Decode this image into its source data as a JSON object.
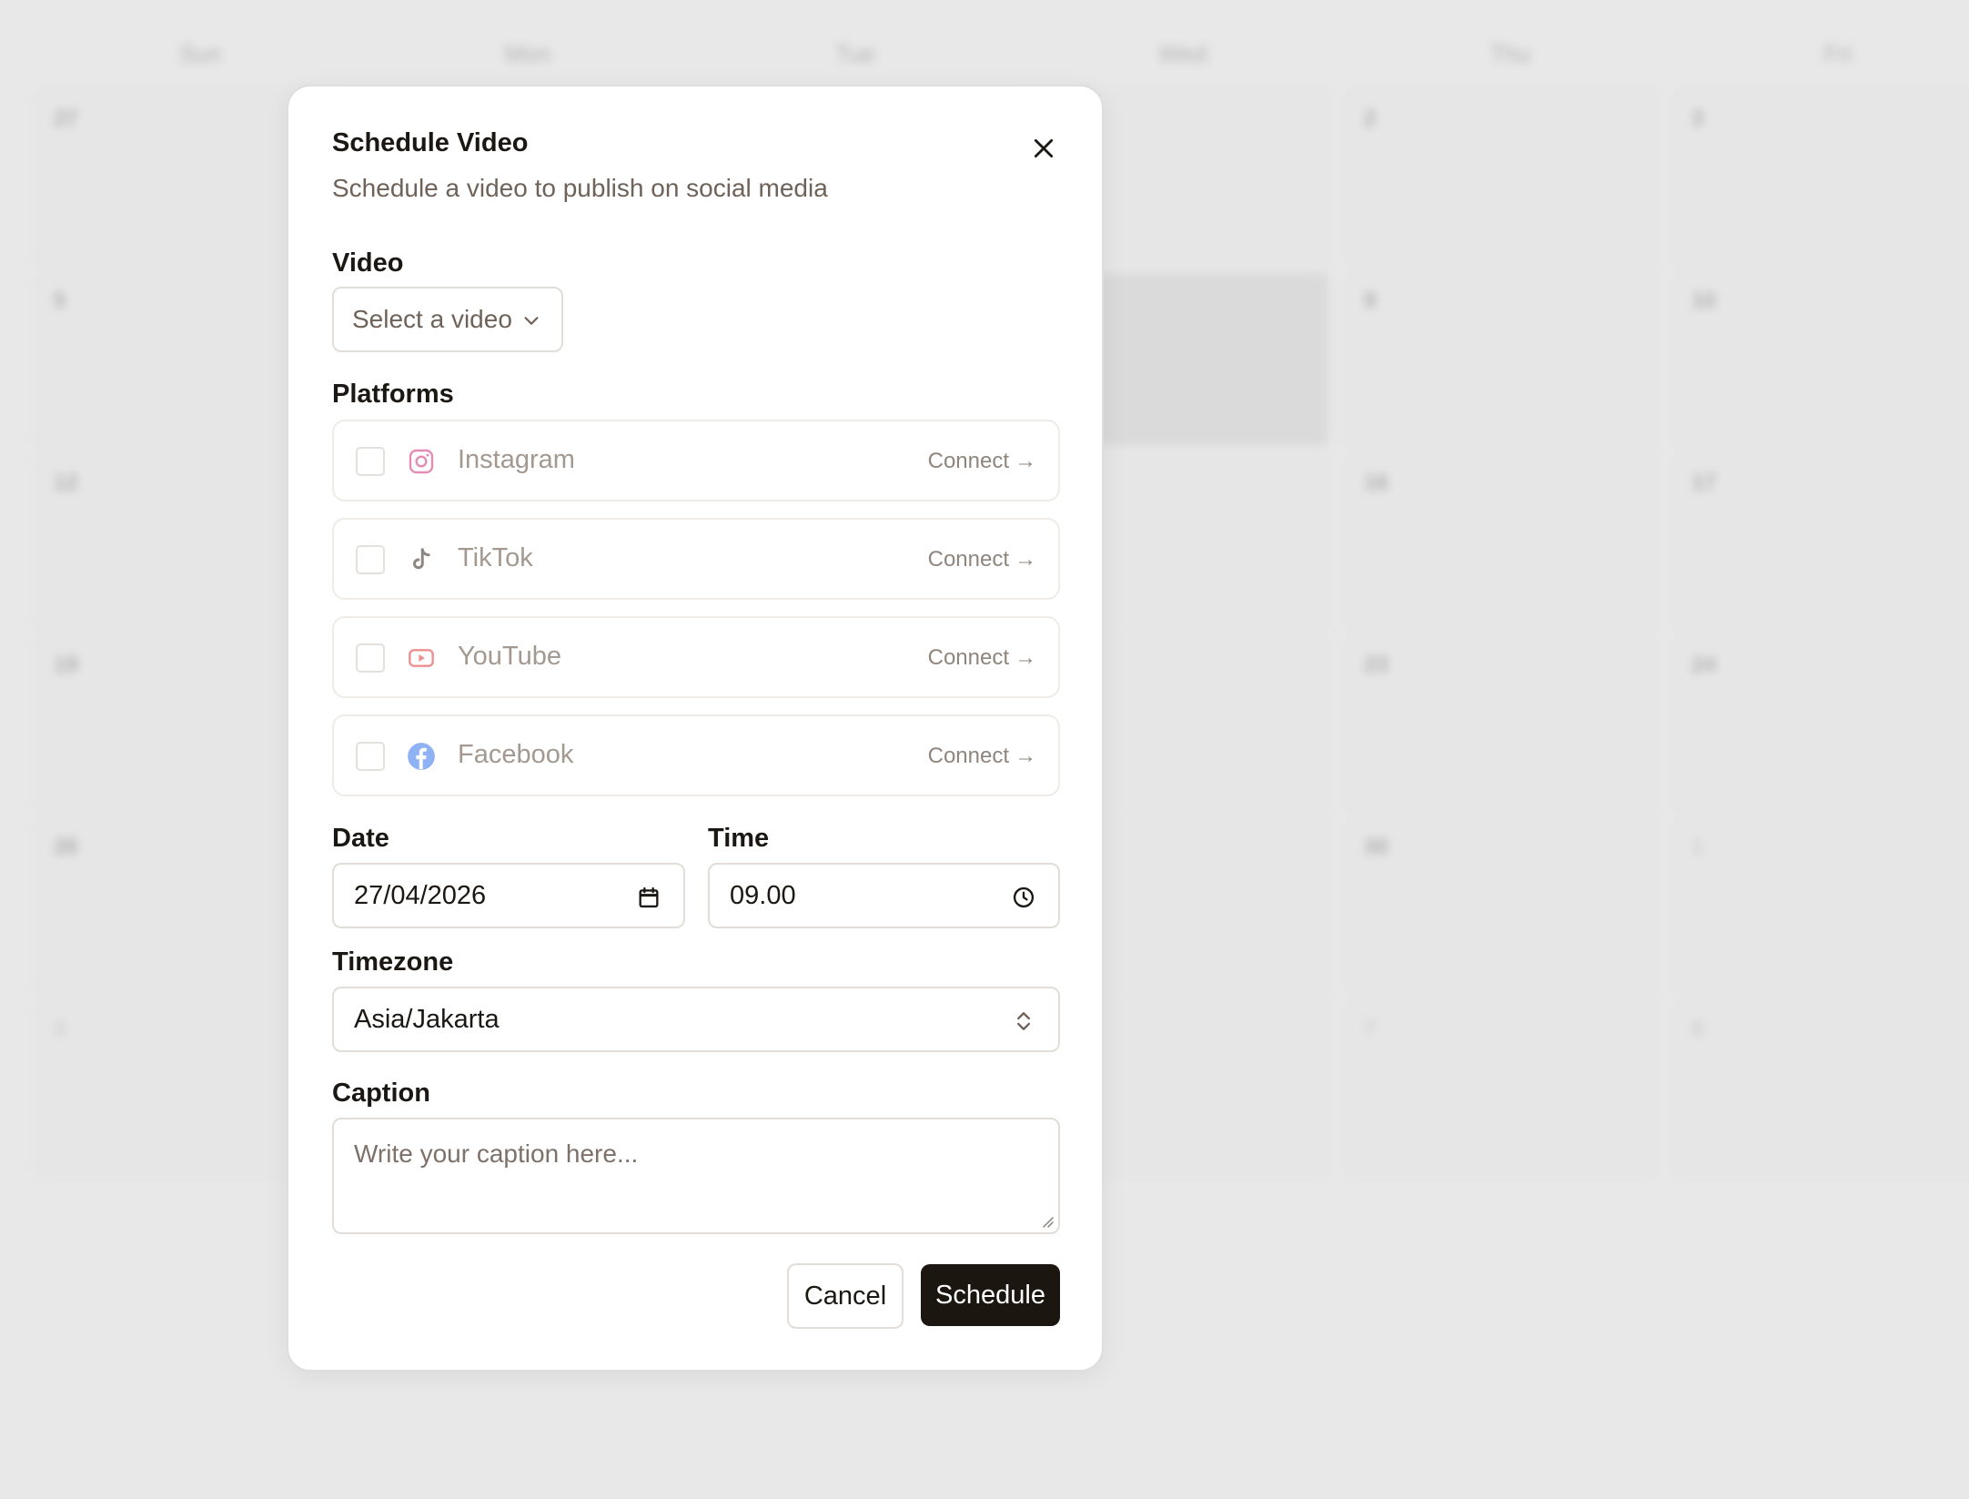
{
  "calendar": {
    "weekdays": [
      "Sun",
      "Mon",
      "Tue",
      "Wed",
      "Thu",
      "Fri"
    ],
    "dates": {
      "row1": [
        "27",
        "2",
        "3"
      ],
      "row2": [
        "5",
        "9",
        "10"
      ],
      "row3": [
        "12",
        "16",
        "17"
      ],
      "row4": [
        "19",
        "23",
        "24"
      ],
      "row5": [
        "26",
        "30",
        "1"
      ],
      "row6": [
        "3",
        "7",
        "8"
      ]
    }
  },
  "modal": {
    "title": "Schedule Video",
    "subtitle": "Schedule a video to publish on social media",
    "close_icon": "close-icon"
  },
  "video": {
    "label": "Video",
    "placeholder": "Select a video"
  },
  "platforms": {
    "label": "Platforms",
    "items": [
      {
        "name": "Instagram",
        "icon": "instagram-icon",
        "action": "Connect",
        "color": "#e58cb4"
      },
      {
        "name": "TikTok",
        "icon": "tiktok-icon",
        "action": "Connect",
        "color": "#8e8680"
      },
      {
        "name": "YouTube",
        "icon": "youtube-icon",
        "action": "Connect",
        "color": "#ec8f8f"
      },
      {
        "name": "Facebook",
        "icon": "facebook-icon",
        "action": "Connect",
        "color": "#8fb2f5"
      }
    ]
  },
  "date": {
    "label": "Date",
    "value": "27/04/2026"
  },
  "time": {
    "label": "Time",
    "value": "09.00"
  },
  "timezone": {
    "label": "Timezone",
    "value": "Asia/Jakarta"
  },
  "caption": {
    "label": "Caption",
    "placeholder": "Write your caption here..."
  },
  "actions": {
    "cancel": "Cancel",
    "schedule": "Schedule"
  },
  "colors": {
    "primary": "#1c1611",
    "muted_text": "#6f6259",
    "border": "#e2ddd8"
  }
}
